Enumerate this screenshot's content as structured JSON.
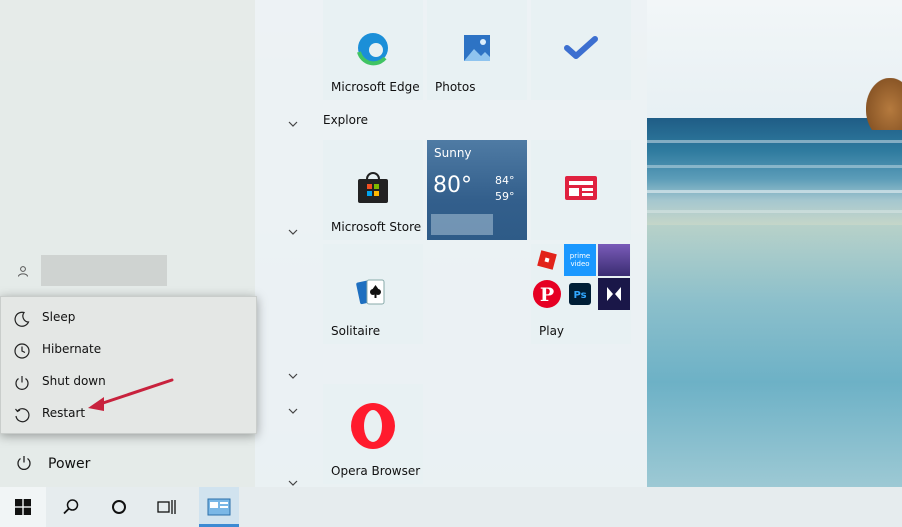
{
  "power_menu": {
    "items": [
      {
        "label": "Sleep",
        "icon": "moon-icon"
      },
      {
        "label": "Hibernate",
        "icon": "clock-icon"
      },
      {
        "label": "Shut down",
        "icon": "power-icon"
      },
      {
        "label": "Restart",
        "icon": "restart-icon"
      }
    ]
  },
  "left_pane": {
    "power_label": "Power"
  },
  "groups": {
    "explore_label": "Explore"
  },
  "tiles": {
    "edge": "Microsoft Edge",
    "photos": "Photos",
    "store": "Microsoft Store",
    "solitaire": "Solitaire",
    "play": "Play",
    "opera": "Opera Browser"
  },
  "weather": {
    "condition": "Sunny",
    "temp": "80°",
    "high": "84°",
    "low": "59°"
  },
  "colors": {
    "accent": "#3c8ad3",
    "annotation_arrow": "#c8223d",
    "weather_tile": "#335f8c"
  }
}
